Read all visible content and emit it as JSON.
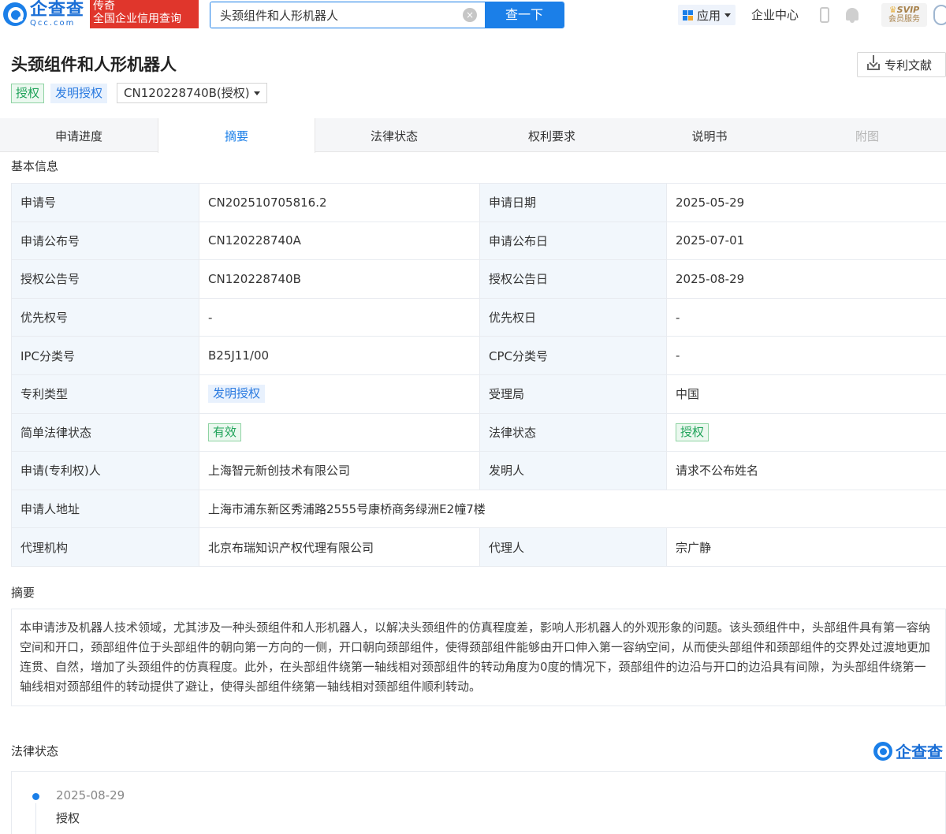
{
  "header": {
    "logo_cn": "企查查",
    "logo_en": "Qcc.com",
    "badge_line1": "传奇",
    "badge_line2": "全国企业信用查询",
    "search_value": "头颈组件和人形机器人",
    "search_button": "查一下",
    "nav_app": "应用",
    "nav_enterprise": "企业中心",
    "svip_top": "SVIP",
    "svip_bottom": "会员服务"
  },
  "title": {
    "text": "头颈组件和人形机器人",
    "download": "专利文献",
    "tags": [
      "授权",
      "发明授权"
    ],
    "publication_select": "CN120228740B(授权)"
  },
  "tabs": [
    {
      "label": "申请进度",
      "state": "normal"
    },
    {
      "label": "摘要",
      "state": "active"
    },
    {
      "label": "法律状态",
      "state": "normal"
    },
    {
      "label": "权利要求",
      "state": "normal"
    },
    {
      "label": "说明书",
      "state": "normal"
    },
    {
      "label": "附图",
      "state": "disabled"
    }
  ],
  "basic_info": {
    "heading": "基本信息",
    "rows": [
      {
        "k1": "申请号",
        "v1": "CN202510705816.2",
        "k2": "申请日期",
        "v2": "2025-05-29"
      },
      {
        "k1": "申请公布号",
        "v1": "CN120228740A",
        "k2": "申请公布日",
        "v2": "2025-07-01"
      },
      {
        "k1": "授权公告号",
        "v1": "CN120228740B",
        "k2": "授权公告日",
        "v2": "2025-08-29"
      },
      {
        "k1": "优先权号",
        "v1": "-",
        "k2": "优先权日",
        "v2": "-"
      },
      {
        "k1": "IPC分类号",
        "v1": "B25J11/00",
        "k2": "CPC分类号",
        "v2": "-"
      },
      {
        "k1": "专利类型",
        "v1": "发明授权",
        "k2": "受理局",
        "v2": "中国"
      },
      {
        "k1": "简单法律状态",
        "v1": "有效",
        "k2": "法律状态",
        "v2": "授权"
      },
      {
        "k1": "申请(专利权)人",
        "v1": "上海智元新创技术有限公司",
        "k2": "发明人",
        "v2": "请求不公布姓名"
      },
      {
        "k1": "申请人地址",
        "v1": "上海市浦东新区秀浦路2555号康桥商务绿洲E2幢7楼"
      },
      {
        "k1": "代理机构",
        "v1": "北京布瑞知识产权代理有限公司",
        "k2": "代理人",
        "v2": "宗广静"
      }
    ]
  },
  "abstract": {
    "heading": "摘要",
    "text": "本申请涉及机器人技术领域，尤其涉及一种头颈组件和人形机器人，以解决头颈组件的仿真程度差，影响人形机器人的外观形象的问题。该头颈组件中，头部组件具有第一容纳空间和开口，颈部组件位于头部组件的朝向第一方向的一侧，开口朝向颈部组件，使得颈部组件能够由开口伸入第一容纳空间，从而使头部组件和颈部组件的交界处过渡地更加连贯、自然，增加了头颈组件的仿真程度。此外，在头部组件绕第一轴线相对颈部组件的转动角度为0度的情况下，颈部组件的边沿与开口的边沿具有间隙，为头部组件绕第一轴线相对颈部组件的转动提供了避让，使得头部组件绕第一轴线相对颈部组件顺利转动。"
  },
  "legal_status": {
    "heading": "法律状态",
    "logo_text": "企查查",
    "events": [
      {
        "date": "2025-08-29",
        "status": "授权"
      }
    ]
  },
  "colors": {
    "accent": "#1b7fe8",
    "brand_red": "#e0362c",
    "status_green": "#20a35a",
    "key_cell_bg": "#f2f7fc"
  }
}
